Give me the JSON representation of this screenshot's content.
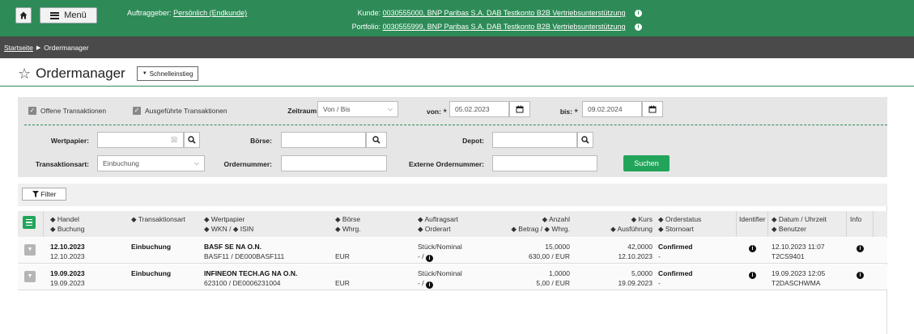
{
  "header": {
    "menu_label": "Menü",
    "auftraggeber_label": "Auftraggeber:",
    "auftraggeber_value": "Persönlich (Endkunde)",
    "kunde_label": "Kunde:",
    "kunde_value": "0030555000, BNP Paribas S.A. DAB Testkonto B2B Vertriebsunterstützung",
    "portfolio_label": "Portfolio:",
    "portfolio_value": "0030555999, BNP Paribas S.A. DAB Testkonto B2B Vertriebsunterstützung",
    "info_glyph": "i"
  },
  "breadcrumb": {
    "home": "Startseite",
    "separator": "▶",
    "current": "Ordermanager"
  },
  "page": {
    "title": "Ordermanager",
    "quick_entry": "Schnelleinstieg"
  },
  "filters": {
    "open_tx_label": "Offene Transaktionen",
    "done_tx_label": "Ausgeführte Transaktionen",
    "zeitraum_label": "Zeitraum:",
    "zeitraum_value": "Von / Bis",
    "von_label": "von:",
    "von_value": "05.02.2023",
    "bis_label": "bis:",
    "bis_value": "09.02.2024",
    "wertpapier_label": "Wertpapier:",
    "boerse_label": "Börse:",
    "depot_label": "Depot:",
    "transaktionsart_label": "Transaktionsart:",
    "transaktionsart_value": "Einbuchung",
    "ordernummer_label": "Ordernummer:",
    "ext_ordernummer_label": "Externe Ordernummer:",
    "search_label": "Suchen",
    "required_mark": "*"
  },
  "toolbar": {
    "filter_label": "Filter"
  },
  "table": {
    "headers": {
      "handel": "Handel",
      "buchung": "Buchung",
      "transaktionsart": "Transaktionsart",
      "wertpapier": "Wertpapier",
      "wkn_isin": "WKN / ◆ ISIN",
      "boerse": "Börse",
      "whrg": "Whrg.",
      "auftragsart": "Auftragsart",
      "orderart": "Orderart",
      "anzahl": "Anzahl",
      "betrag_whrg": "Betrag / ◆ Whrg.",
      "kurs": "Kurs",
      "ausfuehrung": "Ausführung",
      "orderstatus": "Orderstatus",
      "stornoart": "Stornoart",
      "identifier": "Identifier",
      "datum_uhrzeit": "Datum / Uhrzeit",
      "benutzer": "Benutzer",
      "info": "Info"
    },
    "rows": [
      {
        "handel": "12.10.2023",
        "buchung": "12.10.2023",
        "transaktionsart": "Einbuchung",
        "wertpapier": "BASF SE NA O.N.",
        "wkn_isin": "BASF11 / DE000BASF111",
        "boerse": "",
        "whrg": "EUR",
        "auftragsart": "Stück/Nominal",
        "orderart": "- /",
        "anzahl": "15,0000",
        "betrag": "630,00 / EUR",
        "kurs": "42,0000",
        "ausfuehrung": "12.10.2023",
        "orderstatus": "Confirmed",
        "stornoart": "-",
        "datum": "12.10.2023 11:07",
        "benutzer": "T2CS9401"
      },
      {
        "handel": "19.09.2023",
        "buchung": "19.09.2023",
        "transaktionsart": "Einbuchung",
        "wertpapier": "INFINEON TECH.AG NA O.N.",
        "wkn_isin": "623100 / DE0006231004",
        "boerse": "",
        "whrg": "EUR",
        "auftragsart": "Stück/Nominal",
        "orderart": "- /",
        "anzahl": "1,0000",
        "betrag": "5,00 / EUR",
        "kurs": "5,0000",
        "ausfuehrung": "19.09.2023",
        "orderstatus": "Confirmed",
        "stornoart": "-",
        "datum": "19.09.2023 12:05",
        "benutzer": "T2DASCHWMA"
      }
    ]
  },
  "colors": {
    "brand_green": "#2e8b57",
    "button_green": "#22a55a",
    "crumb_bg": "#4a4a4a"
  },
  "icons": [
    "home-icon",
    "menu-icon",
    "info-icon",
    "star-icon",
    "calendar-icon",
    "search-icon",
    "clear-icon",
    "filter-icon",
    "sort-icon",
    "expand-icon",
    "chevron-down-icon"
  ]
}
